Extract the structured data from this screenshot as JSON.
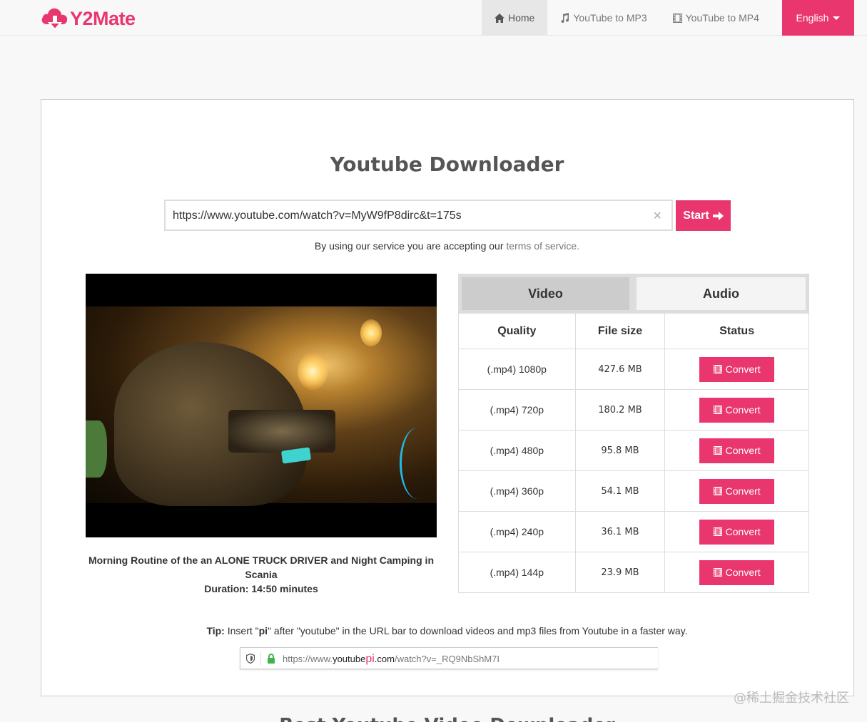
{
  "brand": {
    "name": "Y2Mate",
    "color": "#e9366f"
  },
  "nav": {
    "items": [
      {
        "label": "Home",
        "icon": "home-icon",
        "active": true
      },
      {
        "label": "YouTube to MP3",
        "icon": "music-note-icon",
        "active": false
      },
      {
        "label": "YouTube to MP4",
        "icon": "film-icon",
        "active": false
      }
    ],
    "language": "English"
  },
  "main": {
    "title": "Youtube Downloader",
    "url_value": "https://www.youtube.com/watch?v=MyW9fP8dirc&t=175s",
    "start_label": "Start",
    "terms_prefix": "By using our service you are accepting our",
    "terms_link": "terms of service."
  },
  "video": {
    "title": "Morning Routine of the an ALONE TRUCK DRIVER and Night Camping in Scania",
    "duration": "Duration: 14:50 minutes"
  },
  "tabs": [
    {
      "label": "Video",
      "active": true
    },
    {
      "label": "Audio",
      "active": false
    }
  ],
  "table": {
    "headers": [
      "Quality",
      "File size",
      "Status"
    ],
    "rows": [
      {
        "quality": "(.mp4) 1080p",
        "size": "427.6 MB",
        "action": "Convert"
      },
      {
        "quality": "(.mp4) 720p",
        "size": "180.2 MB",
        "action": "Convert"
      },
      {
        "quality": "(.mp4) 480p",
        "size": "95.8 MB",
        "action": "Convert"
      },
      {
        "quality": "(.mp4) 360p",
        "size": "54.1 MB",
        "action": "Convert"
      },
      {
        "quality": "(.mp4) 240p",
        "size": "36.1 MB",
        "action": "Convert"
      },
      {
        "quality": "(.mp4) 144p",
        "size": "23.9 MB",
        "action": "Convert"
      }
    ]
  },
  "tip": {
    "label": "Tip:",
    "text_1": " Insert \"",
    "pi": "pi",
    "text_2": "\" after \"youtube\" in the URL bar to download videos and mp3 files from Youtube in a faster way.",
    "example_url_prefix": "https://www.",
    "example_url_youtube": "youtube",
    "example_url_pi": "pi",
    "example_url_com": ".com",
    "example_url_path": "/watch?v=_RQ9NbShM7I"
  },
  "watermark": "@稀土掘金技术社区",
  "next_heading": "Best Youtube Video Downloader"
}
